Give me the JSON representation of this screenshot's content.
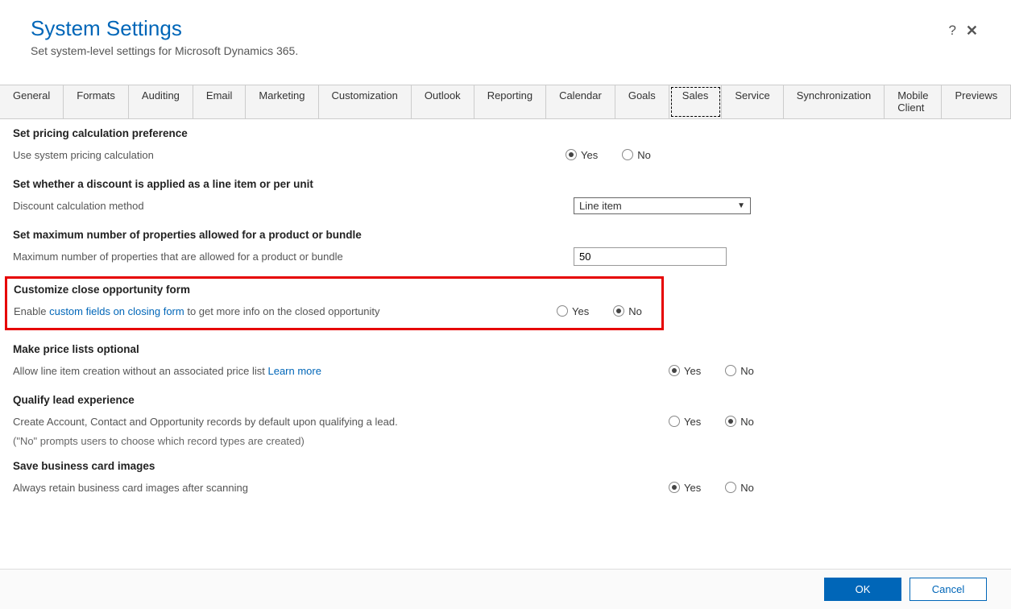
{
  "header": {
    "title": "System Settings",
    "subtitle": "Set system-level settings for Microsoft Dynamics 365."
  },
  "tabs": [
    "General",
    "Formats",
    "Auditing",
    "Email",
    "Marketing",
    "Customization",
    "Outlook",
    "Reporting",
    "Calendar",
    "Goals",
    "Sales",
    "Service",
    "Synchronization",
    "Mobile Client",
    "Previews"
  ],
  "active_tab": "Sales",
  "sections": {
    "pricing": {
      "heading": "Set pricing calculation preference",
      "label": "Use system pricing calculation",
      "yes": "Yes",
      "no": "No",
      "selected": "yes"
    },
    "discount": {
      "heading": "Set whether a discount is applied as a line item or per unit",
      "label": "Discount calculation method",
      "select_value": "Line item"
    },
    "maxprops": {
      "heading": "Set maximum number of properties allowed for a product or bundle",
      "label": "Maximum number of properties that are allowed for a product or bundle",
      "value": "50"
    },
    "closeform": {
      "heading": "Customize close opportunity form",
      "label_pre": "Enable ",
      "label_link": "custom fields on closing form",
      "label_post": " to get more info on the closed opportunity",
      "yes": "Yes",
      "no": "No",
      "selected": "no"
    },
    "pricelist": {
      "heading": "Make price lists optional",
      "label_pre": "Allow line item creation without an associated price list ",
      "label_link": "Learn more",
      "yes": "Yes",
      "no": "No",
      "selected": "yes"
    },
    "qualify": {
      "heading": "Qualify lead experience",
      "label": "Create Account, Contact and Opportunity records by default upon qualifying a lead.",
      "note": "(\"No\" prompts users to choose which record types are created)",
      "yes": "Yes",
      "no": "No",
      "selected": "no"
    },
    "bizcard": {
      "heading": "Save business card images",
      "label": "Always retain business card images after scanning",
      "yes": "Yes",
      "no": "No",
      "selected": "yes"
    }
  },
  "footer": {
    "ok": "OK",
    "cancel": "Cancel"
  }
}
